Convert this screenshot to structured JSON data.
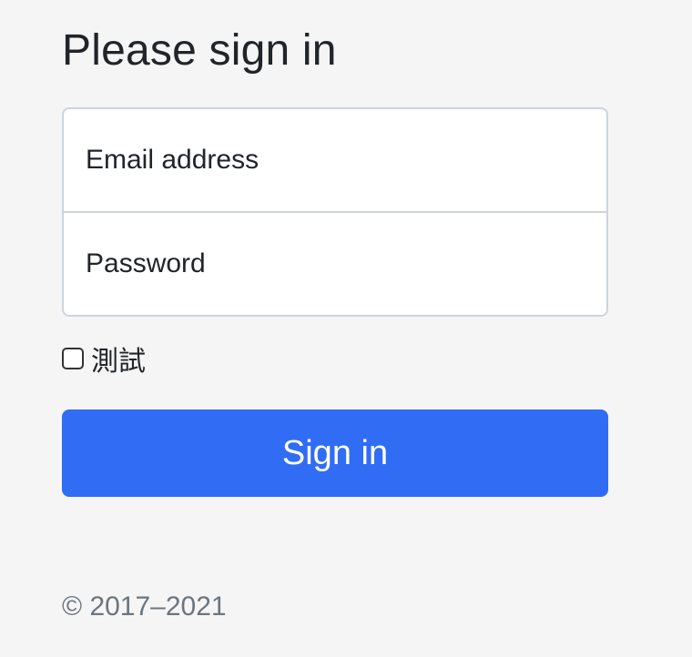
{
  "page": {
    "title": "Please sign in"
  },
  "form": {
    "email_placeholder": "Email address",
    "password_placeholder": "Password",
    "checkbox_label": "測試",
    "checkbox_checked": false,
    "submit_label": "Sign in"
  },
  "footer": {
    "copyright": "© 2017–2021"
  },
  "colors": {
    "background": "#f5f5f5",
    "primary": "#316cf4",
    "muted_text": "#6c757d",
    "border": "#ced4da"
  }
}
